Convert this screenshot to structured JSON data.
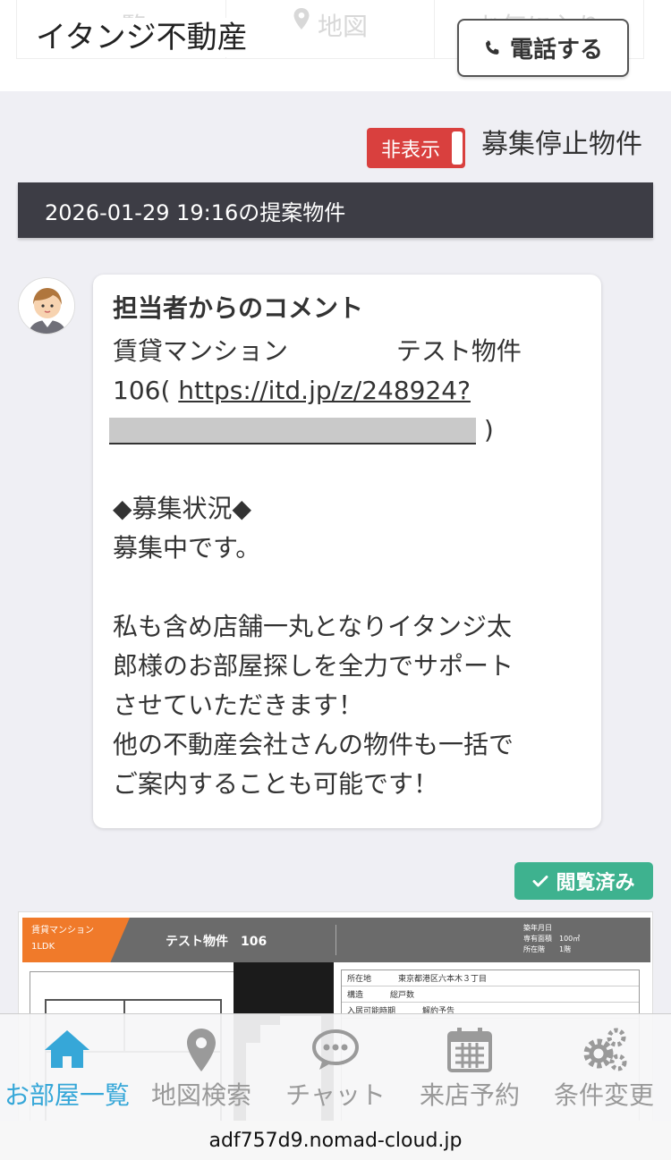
{
  "header": {
    "ghost_tabs": [
      "一覧",
      "地図",
      "お気に入り"
    ],
    "company_name": "イタンジ不動産",
    "call_button_label": "電話する"
  },
  "filter": {
    "toggle_label": "非表示",
    "toggle_caption": "募集停止物件"
  },
  "section": {
    "title": "2026-01-29 19:16の提案物件"
  },
  "comment": {
    "title": "担当者からのコメント",
    "line1_prefix": "賃貸マンション ",
    "line1_suffix": "テスト物件",
    "line2_prefix": "106( ",
    "link_text": "https://itd.jp/z/248924?",
    "line3_suffix": " )",
    "status_heading": "◆募集状況◆",
    "status_text": "募集中です。",
    "message_lines": [
      "私も含め店舗一丸となりイタンジ太",
      "郎様のお部屋探しを全力でサポート",
      "させていただきます！",
      "他の不動産会社さんの物件も一括で",
      "ご案内することも可能です！"
    ]
  },
  "badge": {
    "viewed_label": "閲覧済み"
  },
  "property": {
    "type_label": "賃貸マンション",
    "layout": "1LDK",
    "name": "テスト物件　106",
    "meta_lines": [
      "築年月日",
      "専有面積　100㎡",
      "所在階　　1階"
    ],
    "table_rows": [
      {
        "k": "所在地",
        "v": "東京都港区六本木３丁目"
      },
      {
        "k": "構造",
        "v": "総戸数"
      },
      {
        "k": "入居可能時期",
        "v": "解約予告"
      }
    ]
  },
  "tabbar": {
    "items": [
      {
        "label": "お部屋一覧",
        "icon": "home-icon",
        "active": true
      },
      {
        "label": "地図検索",
        "icon": "map-pin-icon",
        "active": false
      },
      {
        "label": "チャット",
        "icon": "chat-icon",
        "active": false
      },
      {
        "label": "来店予約",
        "icon": "calendar-icon",
        "active": false
      },
      {
        "label": "条件変更",
        "icon": "gears-icon",
        "active": false
      }
    ]
  },
  "browser": {
    "url": "adf757d9.nomad-cloud.jp"
  },
  "colors": {
    "accent_blue": "#36a7d8",
    "toggle_red": "#d9403e",
    "viewed_green": "#3eb28f",
    "section_dark": "#3d3d45",
    "property_orange": "#f07a2a"
  }
}
